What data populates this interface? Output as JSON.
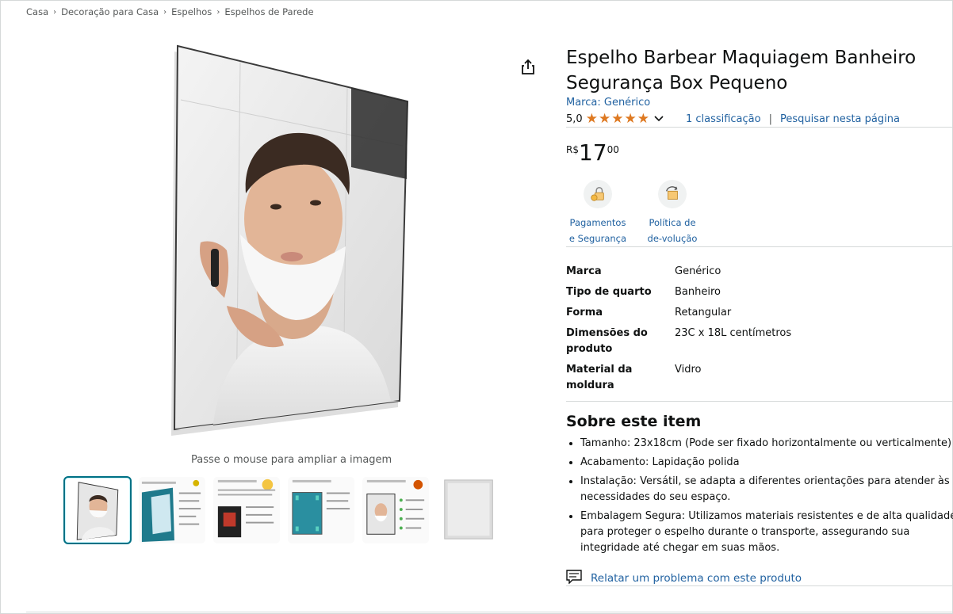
{
  "breadcrumb": [
    "Casa",
    "Decoração para Casa",
    "Espelhos",
    "Espelhos de Parede"
  ],
  "product": {
    "title": "Espelho Barbear Maquiagem Banheiro Segurança Box Pequeno",
    "brand_link": "Marca: Genérico",
    "rating_value": "5,0",
    "rating_stars": 5,
    "rating_count": "1 classificação",
    "search_page": "Pesquisar nesta página",
    "price_currency": "R$",
    "price_whole": "17",
    "price_fraction": "00"
  },
  "features": [
    {
      "label": "Pagamentos e Segurança",
      "icon": "lock-payment-icon"
    },
    {
      "label": "Política de de-volução",
      "icon": "return-box-icon"
    }
  ],
  "specs": [
    {
      "key": "Marca",
      "value": "Genérico"
    },
    {
      "key": "Tipo de quarto",
      "value": "Banheiro"
    },
    {
      "key": "Forma",
      "value": "Retangular"
    },
    {
      "key": "Dimensões do produto",
      "value": "23C x 18L centímetros"
    },
    {
      "key": "Material da moldura",
      "value": "Vidro"
    }
  ],
  "about": {
    "heading": "Sobre este item",
    "bullets": [
      "Tamanho: 23x18cm (Pode ser fixado horizontalmente ou verticalmente)",
      "Acabamento: Lapidação polida",
      "Instalação: Versátil, se adapta a diferentes orientações para atender às necessidades do seu espaço.",
      "Embalagem Segura: Utilizamos materiais resistentes e de alta qualidade para proteger o espelho durante o transporte, assegurando sua integridade até chegar em suas mãos."
    ]
  },
  "report_link": "Relatar um problema com este produto",
  "gallery": {
    "hover_hint": "Passe o mouse para ampliar a imagem",
    "thumb_count": 6,
    "selected_index": 0
  },
  "colors": {
    "link": "#2162a1",
    "star": "#de7921",
    "selected_thumb": "#007185"
  }
}
